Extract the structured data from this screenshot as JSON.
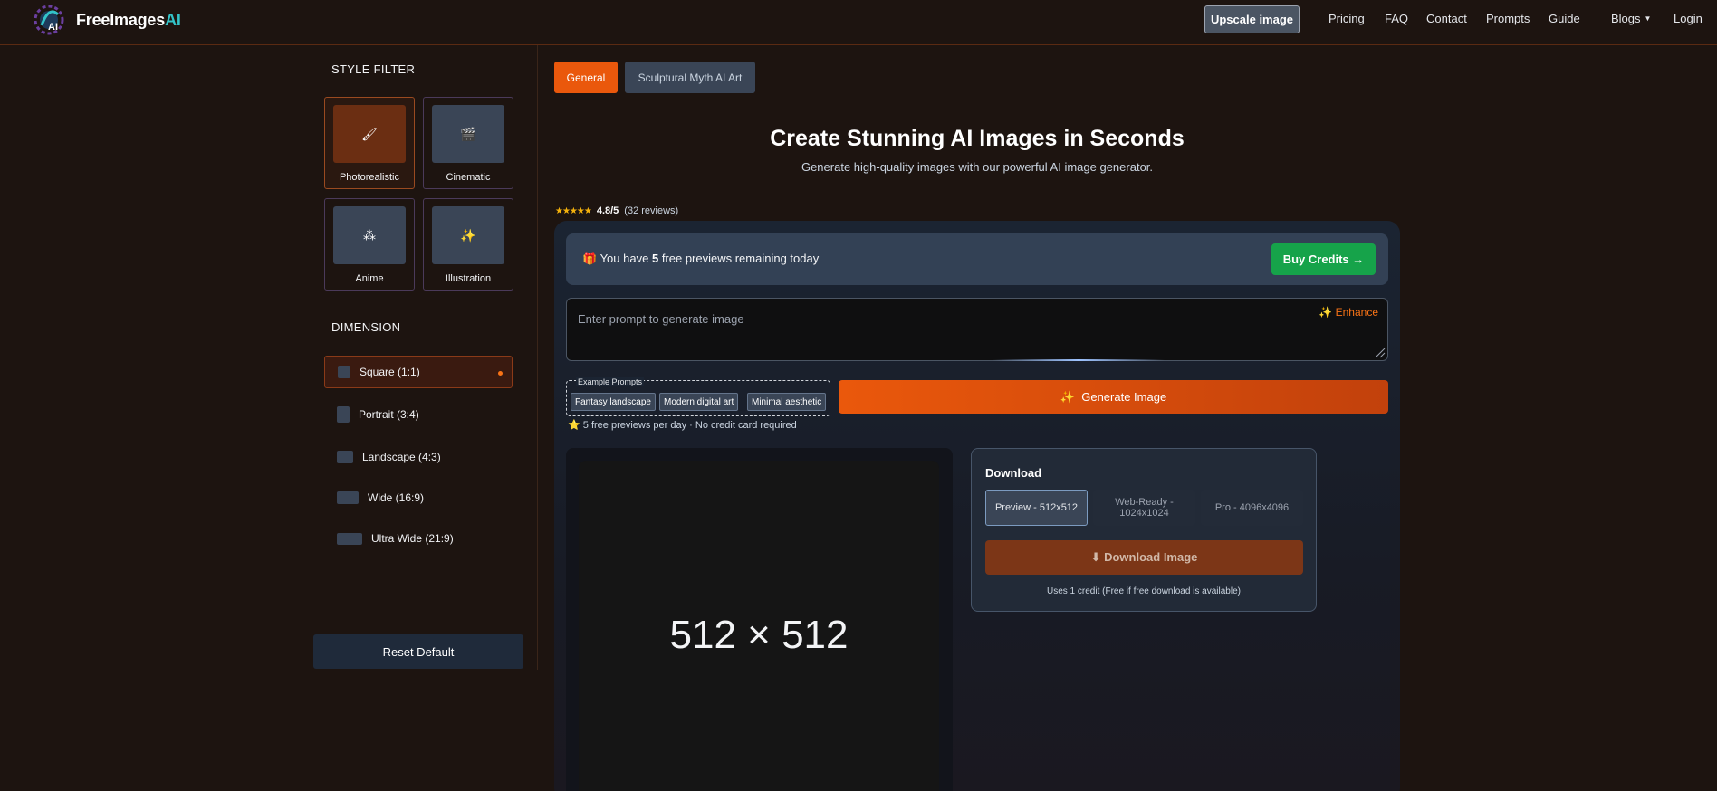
{
  "header": {
    "logo_text": "FreeImages",
    "logo_ai": "AI",
    "upscale_label": "Upscale image",
    "nav": [
      "Pricing",
      "FAQ",
      "Contact",
      "Prompts",
      "Guide",
      "Blogs",
      "Login"
    ]
  },
  "sidebar": {
    "style_title": "STYLE FILTER",
    "styles": [
      {
        "label": "Photorealistic",
        "icon": "brush-icon"
      },
      {
        "label": "Cinematic",
        "icon": "clapperboard-icon"
      },
      {
        "label": "Anime",
        "icon": "shapes-icon"
      },
      {
        "label": "Illustration",
        "icon": "magic-wand-icon"
      }
    ],
    "dimension_title": "DIMENSION",
    "dimensions": [
      "Square (1:1)",
      "Portrait (3:4)",
      "Landscape (4:3)",
      "Wide (16:9)",
      "Ultra Wide (21:9)"
    ],
    "reset_label": "Reset Default"
  },
  "tabs": [
    "General",
    "Sculptural Myth AI Art"
  ],
  "hero": {
    "title": "Create Stunning AI Images in Seconds",
    "subtitle": "Generate high-quality images with our powerful AI image generator."
  },
  "rating": {
    "stars": "★★★★★",
    "score": "4.8/5",
    "reviews": "(32 reviews)"
  },
  "previews": {
    "prefix": "You have",
    "count": "5",
    "suffix": "free previews remaining today",
    "buy_label": "Buy Credits →"
  },
  "prompt": {
    "placeholder": "Enter prompt to generate image",
    "enhance_label": "Enhance"
  },
  "examples": {
    "label": "Example Prompts",
    "chips": [
      "Fantasy landscape",
      "Modern digital art",
      "Minimal aesthetic"
    ]
  },
  "free_note": "5 free previews per day · No credit card required",
  "generate_label": "Generate Image",
  "preview": {
    "size_text": "512 × 512"
  },
  "download": {
    "title": "Download",
    "options": [
      "Preview - 512x512",
      "Web-Ready - 1024x1024",
      "Pro - 4096x4096"
    ],
    "button_label": "⬇ Download Image",
    "note": "Uses 1 credit (Free if free download is available)"
  },
  "colors": {
    "accent": "#ea580c",
    "buy": "#16a34a",
    "logo_ai": "#33c3c8"
  }
}
